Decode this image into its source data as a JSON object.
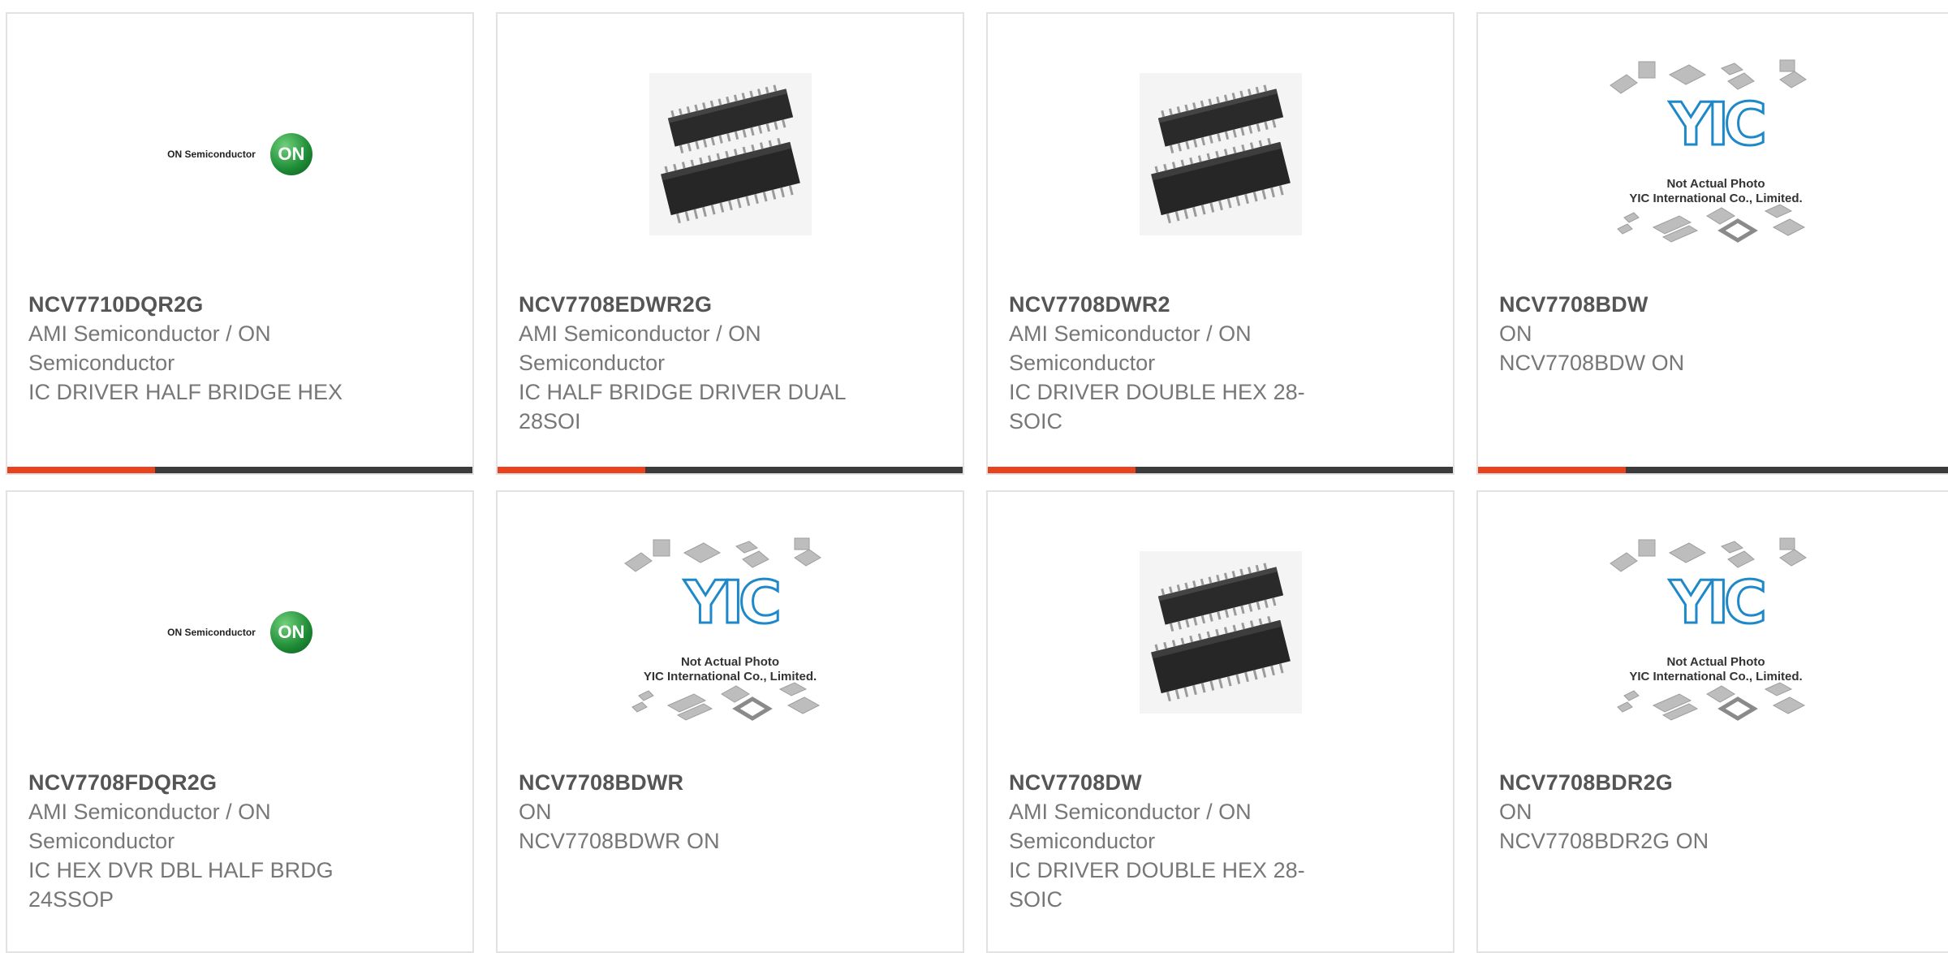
{
  "cards": [
    {
      "part": "NCV7710DQR2G",
      "maker": "AMI Semiconductor / ON Semiconductor",
      "desc": "IC DRIVER HALF BRIDGE HEX",
      "image": "on-semi-logo",
      "logo_text": "ON Semiconductor",
      "logo_mark": "ON"
    },
    {
      "part": "NCV7708EDWR2G",
      "maker": "AMI Semiconductor / ON Semiconductor",
      "desc": "IC HALF BRIDGE DRIVER DUAL 28SOI",
      "image": "soic-chip-photo"
    },
    {
      "part": "NCV7708DWR2",
      "maker": "AMI Semiconductor / ON Semiconductor",
      "desc": "IC DRIVER DOUBLE HEX 28-SOIC",
      "image": "soic-chip-photo"
    },
    {
      "part": "NCV7708BDW",
      "maker": "ON",
      "desc": "NCV7708BDW ON",
      "image": "yic-placeholder",
      "yic_line1": "Not Actual Photo",
      "yic_line2": "YIC International Co., Limited."
    },
    {
      "part": "NCV7708FDQR2G",
      "maker": "AMI Semiconductor / ON Semiconductor",
      "desc": "IC HEX DVR DBL HALF BRDG 24SSOP",
      "image": "on-semi-logo",
      "logo_text": "ON Semiconductor",
      "logo_mark": "ON"
    },
    {
      "part": "NCV7708BDWR",
      "maker": "ON",
      "desc": "NCV7708BDWR ON",
      "image": "yic-placeholder",
      "yic_line1": "Not Actual Photo",
      "yic_line2": "YIC International Co., Limited."
    },
    {
      "part": "NCV7708DW",
      "maker": "AMI Semiconductor / ON Semiconductor",
      "desc": "IC DRIVER DOUBLE HEX 28-SOIC",
      "image": "soic-chip-photo"
    },
    {
      "part": "NCV7708BDR2G",
      "maker": "ON",
      "desc": "NCV7708BDR2G ON",
      "image": "yic-placeholder",
      "yic_line1": "Not Actual Photo",
      "yic_line2": "YIC International Co., Limited."
    }
  ],
  "colors": {
    "accent": "#e8431c",
    "bar": "#3b3b3b",
    "border": "#e2e2e2",
    "part_text": "#555555",
    "body_text": "#777777",
    "yic_blue": "#1e88c8"
  }
}
